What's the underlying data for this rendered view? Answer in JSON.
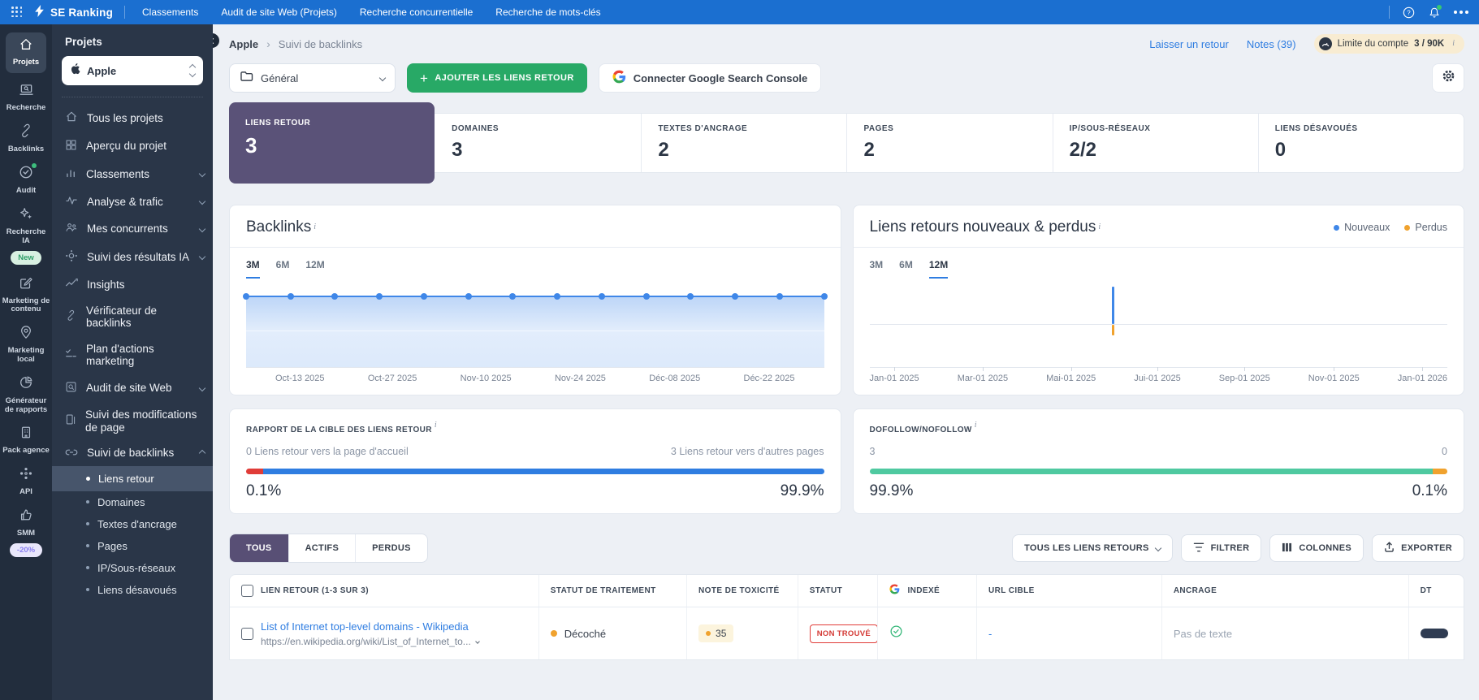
{
  "navbar": {
    "brand": "SE Ranking",
    "items": [
      "Classements",
      "Audit de site Web (Projets)",
      "Recherche concurrentielle",
      "Recherche de mots-clés"
    ]
  },
  "rail": {
    "items": [
      {
        "label": "Projets",
        "active": true
      },
      {
        "label": "Recherche"
      },
      {
        "label": "Backlinks"
      },
      {
        "label": "Audit"
      },
      {
        "label": "Recherche IA",
        "badge": "New"
      },
      {
        "label": "Marketing de contenu"
      },
      {
        "label": "Marketing local"
      },
      {
        "label": "Générateur de rapports"
      },
      {
        "label": "Pack agence"
      },
      {
        "label": "API"
      },
      {
        "label": "SMM",
        "badge": "-20%"
      }
    ]
  },
  "sidebar": {
    "title": "Projets",
    "project": "Apple",
    "items": [
      {
        "label": "Tous les projets"
      },
      {
        "label": "Aperçu du projet"
      },
      {
        "label": "Classements",
        "chevron": "down"
      },
      {
        "label": "Analyse & trafic",
        "chevron": "down"
      },
      {
        "label": "Mes concurrents",
        "chevron": "down"
      },
      {
        "label": "Suivi des résultats IA",
        "chevron": "down"
      },
      {
        "label": "Insights"
      },
      {
        "label": "Vérificateur de backlinks"
      },
      {
        "label": "Plan d'actions marketing"
      },
      {
        "label": "Audit de site Web",
        "chevron": "down"
      },
      {
        "label": "Suivi des modifications de page"
      },
      {
        "label": "Suivi de backlinks",
        "chevron": "up",
        "expanded": true
      }
    ],
    "subitems": [
      {
        "label": "Liens retour",
        "active": true
      },
      {
        "label": "Domaines"
      },
      {
        "label": "Textes d'ancrage"
      },
      {
        "label": "Pages"
      },
      {
        "label": "IP/Sous-réseaux"
      },
      {
        "label": "Liens désavoués"
      }
    ]
  },
  "header": {
    "breadcrumb_project": "Apple",
    "breadcrumb_page": "Suivi de backlinks",
    "feedback": "Laisser un retour",
    "notes": "Notes (39)",
    "limit_label": "Limite du compte",
    "limit_value": "3 / 90K"
  },
  "toolbar": {
    "group": "Général",
    "add_button": "AJOUTER LES LIENS RETOUR",
    "gsc_button": "Connecter Google Search Console"
  },
  "stats": [
    {
      "label": "LIENS RETOUR",
      "value": "3",
      "active": true
    },
    {
      "label": "DOMAINES",
      "value": "3"
    },
    {
      "label": "TEXTES D'ANCRAGE",
      "value": "2"
    },
    {
      "label": "PAGES",
      "value": "2"
    },
    {
      "label": "IP/SOUS-RÉSEAUX",
      "value": "2/2"
    },
    {
      "label": "LIENS DÉSAVOUÉS",
      "value": "0"
    }
  ],
  "chart_data": [
    {
      "type": "line",
      "title": "Backlinks",
      "range_tabs": [
        "3M",
        "6M",
        "12M"
      ],
      "active_tab": "3M",
      "series": [
        {
          "name": "Backlinks",
          "values": [
            3,
            3,
            3,
            3,
            3,
            3,
            3,
            3,
            3,
            3,
            3,
            3,
            3,
            3
          ]
        }
      ],
      "x_labels": [
        "Oct-13 2025",
        "Oct-27 2025",
        "Nov-10 2025",
        "Nov-24 2025",
        "Déc-08 2025",
        "Déc-22 2025"
      ],
      "line_color": "#3f87e8",
      "grid": true,
      "legend_position": "none"
    },
    {
      "type": "bar",
      "title": "Liens retours nouveaux & perdus",
      "range_tabs": [
        "3M",
        "6M",
        "12M"
      ],
      "active_tab": "12M",
      "legend": [
        {
          "name": "Nouveaux",
          "color": "#3f87e8"
        },
        {
          "name": "Perdus",
          "color": "#f0a22e"
        }
      ],
      "x_labels": [
        "Jan-01 2025",
        "Mar-01 2025",
        "Mai-01 2025",
        "Jui-01 2025",
        "Sep-01 2025",
        "Nov-01 2025",
        "Jan-01 2026"
      ],
      "bars": [
        {
          "x_frac": 0.42,
          "nouveaux": 3,
          "perdus": 1
        }
      ],
      "ylim": [
        -3,
        3
      ],
      "legend_position": "top-right"
    }
  ],
  "target_report": {
    "title": "RAPPORT DE LA CIBLE DES LIENS RETOUR",
    "left_label": "0 Liens retour vers la page d'accueil",
    "right_label": "3 Liens retour vers d'autres pages",
    "left_pct": "0.1%",
    "right_pct": "99.9%",
    "left_frac": 0.03,
    "colors": {
      "left": "#e03c38",
      "right": "#2f7de1"
    }
  },
  "dofollow": {
    "title": "DOFOLLOW/NOFOLLOW",
    "left_label": "3",
    "right_label": "0",
    "left_pct": "99.9%",
    "right_pct": "0.1%",
    "right_frac": 0.025,
    "colors": {
      "left": "#4fc9a0",
      "right": "#f0a22e"
    }
  },
  "table": {
    "tabs": [
      "TOUS",
      "ACTIFS",
      "PERDUS"
    ],
    "active_tab": "TOUS",
    "filter_dropdown": "TOUS LES LIENS RETOURS",
    "buttons": [
      "FILTRER",
      "COLONNES",
      "EXPORTER"
    ],
    "columns": [
      "LIEN RETOUR (1-3 SUR 3)",
      "STATUT DE TRAITEMENT",
      "NOTE DE TOXICITÉ",
      "STATUT",
      "INDEXÉ",
      "URL CIBLE",
      "ANCRAGE",
      "DT"
    ],
    "rows": [
      {
        "link": "List of Internet top-level domains - Wikipedia",
        "url": "https://en.wikipedia.org/wiki/List_of_Internet_to...",
        "treatment": "Décoché",
        "toxicity": "35",
        "status": "NON TROUVÉ",
        "indexed": true,
        "target_url": "-",
        "anchor": "Pas de texte"
      }
    ]
  },
  "misc": {
    "info": "i"
  },
  "colors": {
    "navbar": "#1b6fd0",
    "accent_blue": "#2f7de1",
    "green_button": "#28a966",
    "active_card_purple": "#5a5278",
    "orange": "#f0a22e",
    "red": "#e03c38",
    "teal_green": "#4fc9a0",
    "sidebar_dark": "#2a3648",
    "rail_dark": "#222d3d"
  }
}
